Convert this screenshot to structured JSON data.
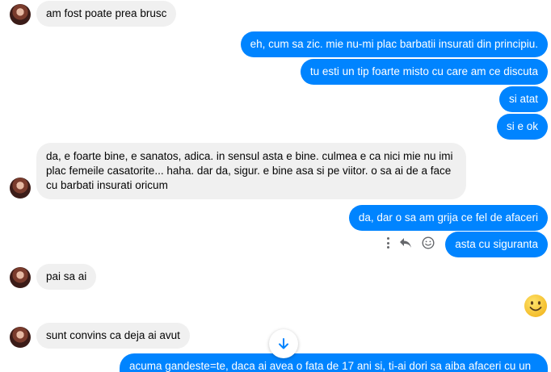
{
  "messages": [
    {
      "from": "them",
      "text": "am fost poate prea brusc"
    },
    {
      "from": "me",
      "text": "eh, cum sa zic. mie nu-mi plac barbatii insurati din principiu."
    },
    {
      "from": "me",
      "text": "tu esti un tip foarte misto cu care am ce discuta"
    },
    {
      "from": "me",
      "text": "si atat"
    },
    {
      "from": "me",
      "text": "si e ok"
    },
    {
      "from": "them",
      "text": "da, e foarte bine, e sanatos, adica. in sensul asta e bine. culmea e ca nici mie nu imi plac femeile casatorite... haha. dar da, sigur. e bine asa si pe viitor. o sa ai de a face cu barbati insurati oricum"
    },
    {
      "from": "me",
      "text": "da, dar o sa am grija ce fel de afaceri"
    },
    {
      "from": "me",
      "text": "asta cu siguranta"
    },
    {
      "from": "them",
      "text": "pai sa ai"
    },
    {
      "from": "me",
      "text": "emoji-smile"
    },
    {
      "from": "them",
      "text": "sunt convins ca deja ai avut"
    },
    {
      "from": "me",
      "text": "acuma gandeste=te, daca ai avea o fata de 17 ani si, ti-ai dori sa aiba afaceri cu un"
    }
  ],
  "icons": {
    "more": "more-vertical-icon",
    "reply": "reply-icon",
    "react": "smiley-icon",
    "scroll": "arrow-down-icon"
  },
  "colors": {
    "outgoing": "#0084ff",
    "incoming": "#f0f0f0",
    "emoji": "#f7c325"
  }
}
